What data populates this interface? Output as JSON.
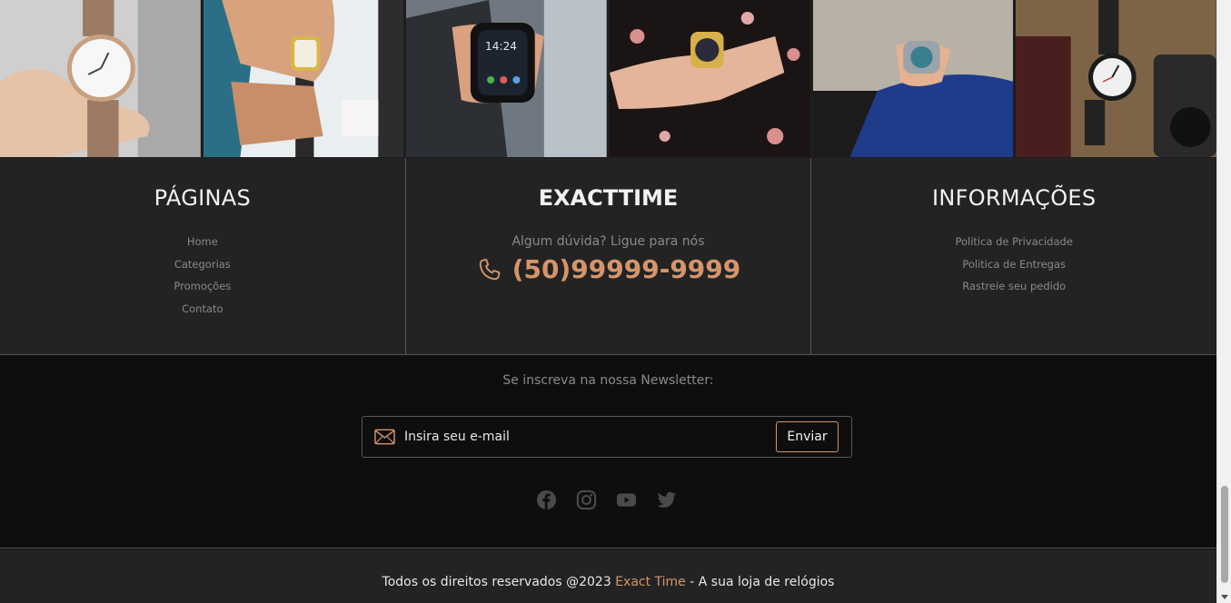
{
  "photos": [
    {
      "name": "photo-watch-hand",
      "alt": "rose gold watch held in hand"
    },
    {
      "name": "photo-watch-suit",
      "alt": "gold watch with white shirt"
    },
    {
      "name": "photo-smartwatch",
      "alt": "black smartwatch"
    },
    {
      "name": "photo-watch-floral",
      "alt": "gold watch on floral dress"
    },
    {
      "name": "photo-watch-blue-suit",
      "alt": "silver watch with blue suit"
    },
    {
      "name": "photo-watch-camera",
      "alt": "black watch with vintage camera"
    }
  ],
  "pages": {
    "title": "PÁGINAS",
    "links": [
      "Home",
      "Categorias",
      "Promoções",
      "Contato"
    ]
  },
  "brand": {
    "title": "EXACTTIME",
    "ask": "Algum dúvida? Ligue para nós",
    "phone": "(50)99999-9999",
    "phone_icon": "phone-icon"
  },
  "info": {
    "title": "INFORMAÇÕES",
    "links": [
      "Politica de Privacidade",
      "Politica de Entregas",
      "Rastreie seu pedido"
    ]
  },
  "newsletter": {
    "label": "Se inscreva na nossa Newsletter:",
    "placeholder": "Insira seu e-mail",
    "button": "Enviar",
    "icon": "mail-icon"
  },
  "social": [
    "facebook-icon",
    "instagram-icon",
    "youtube-icon",
    "twitter-icon"
  ],
  "copyright": {
    "prefix": "Todos os direitos reservados @2023 ",
    "brand": "Exact Time",
    "suffix": " - A sua loja de relógios"
  },
  "colors": {
    "accent": "#d6946b",
    "footer_bg": "#232323",
    "newsletter_bg": "#0e0e0e"
  }
}
